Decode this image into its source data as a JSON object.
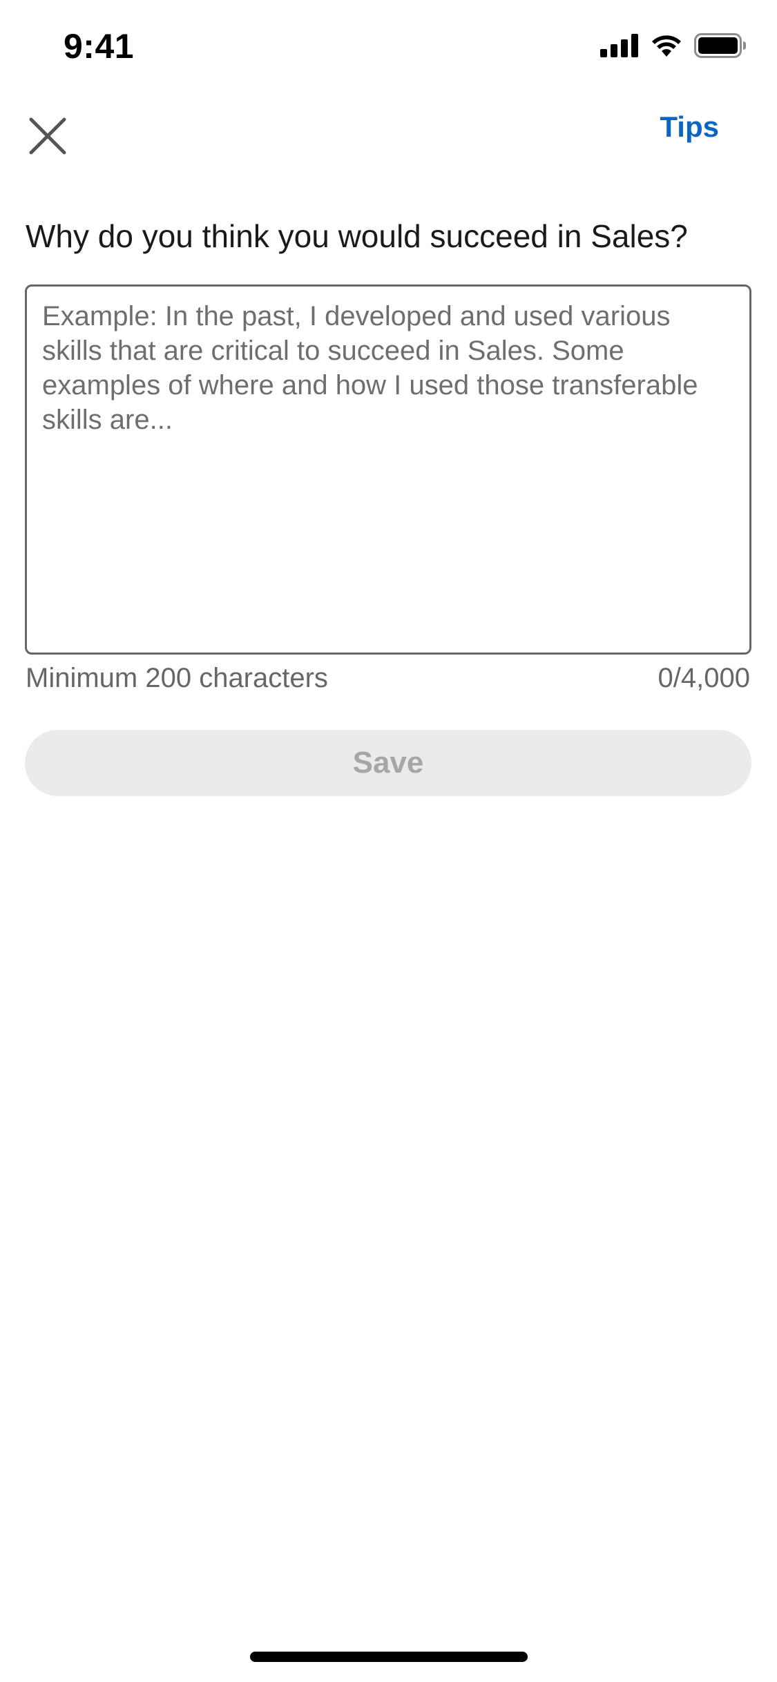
{
  "status_bar": {
    "time": "9:41",
    "icons": [
      "cellular-signal-icon",
      "wifi-icon",
      "battery-icon"
    ]
  },
  "header": {
    "close_icon": "close-icon",
    "tips_label": "Tips"
  },
  "question": {
    "text": "Why do you think you would succeed in Sales?"
  },
  "answer": {
    "value": "",
    "placeholder": "Example: In the past, I developed and used various skills that are critical to succeed in Sales. Some examples of where and how I used those transferable skills are..."
  },
  "helper": {
    "minimum_text": "Minimum 200 characters",
    "char_count": "0/4,000"
  },
  "save_button": {
    "label": "Save"
  },
  "colors": {
    "accent": "#0a66c2",
    "disabled_bg": "#ebebeb",
    "disabled_text": "#a6a6a6",
    "muted_text": "#666666"
  }
}
